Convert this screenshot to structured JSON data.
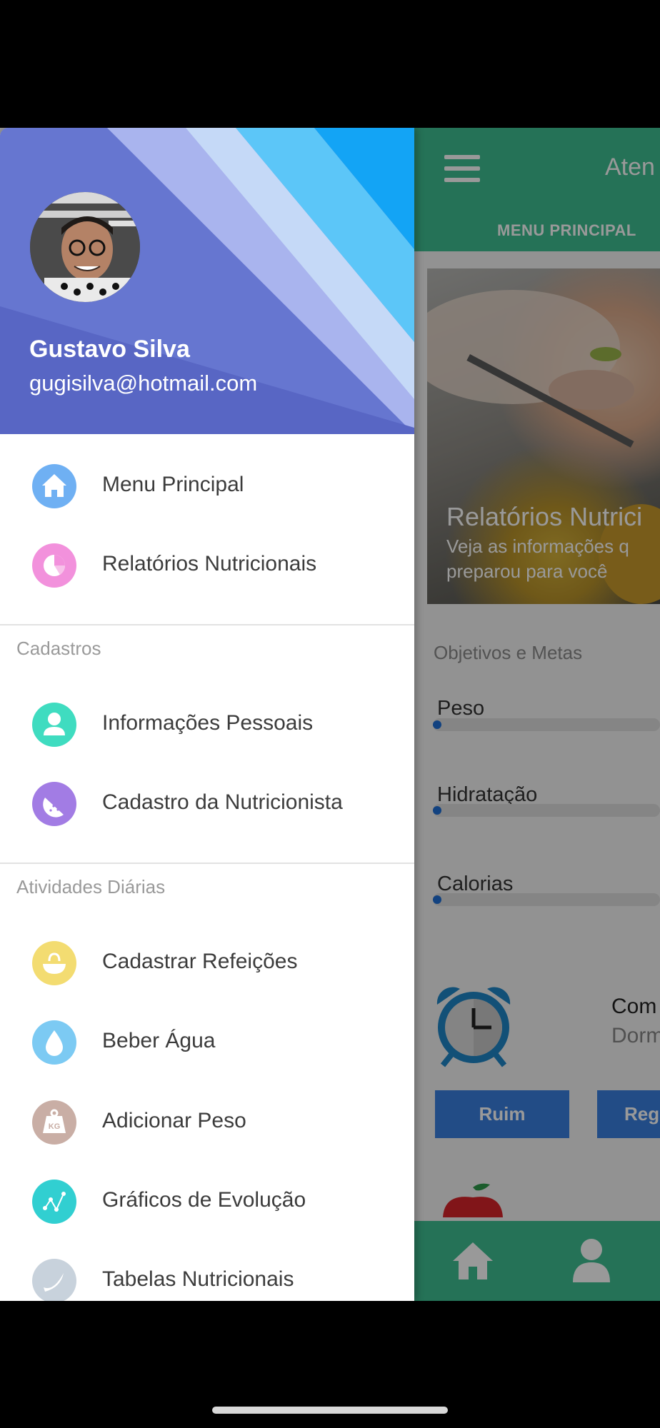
{
  "main": {
    "header_title": "Aten",
    "tab_label": "MENU PRINCIPAL",
    "hero": {
      "title": "Relatórios Nutrici",
      "subtitle": "Veja as informações q preparou para você"
    },
    "goals_section": "Objetivos e Metas",
    "goals": [
      {
        "label": "Peso",
        "progress": 0
      },
      {
        "label": "Hidratação",
        "progress": 0
      },
      {
        "label": "Calorias",
        "progress": 0
      }
    ],
    "sleep_card": {
      "title": "Com",
      "subtitle": "Dorm"
    },
    "buttons": {
      "bad": "Ruim",
      "regular": "Reg"
    },
    "accent_color": "#3fbf92"
  },
  "drawer": {
    "profile": {
      "name": "Gustavo Silva",
      "email": "gugisilva@hotmail.com"
    },
    "items_top": [
      {
        "label": "Menu Principal",
        "icon": "home-icon",
        "color": "#6fb0f3"
      },
      {
        "label": "Relatórios Nutricionais",
        "icon": "pie-chart-icon",
        "color": "#f291dc"
      }
    ],
    "section_cadastros": "Cadastros",
    "items_cadastros": [
      {
        "label": "Informações Pessoais",
        "icon": "user-icon",
        "color": "#3fdcc0"
      },
      {
        "label": "Cadastro da Nutricionista",
        "icon": "watermelon-icon",
        "color": "#a27ce4"
      }
    ],
    "section_atividades": "Atividades Diárias",
    "items_atividades": [
      {
        "label": "Cadastrar Refeições",
        "icon": "bowl-icon",
        "color": "#f3dc71"
      },
      {
        "label": "Beber Água",
        "icon": "water-drop-icon",
        "color": "#7ccaf3"
      },
      {
        "label": "Adicionar Peso",
        "icon": "weight-kg-icon",
        "color": "#c9aea5"
      },
      {
        "label": "Gráficos de Evolução",
        "icon": "graph-nodes-icon",
        "color": "#31cfd1"
      },
      {
        "label": "Tabelas Nutricionais",
        "icon": "banana-icon",
        "color": "#c8d2dc"
      }
    ],
    "weight_icon_text": "KG"
  }
}
